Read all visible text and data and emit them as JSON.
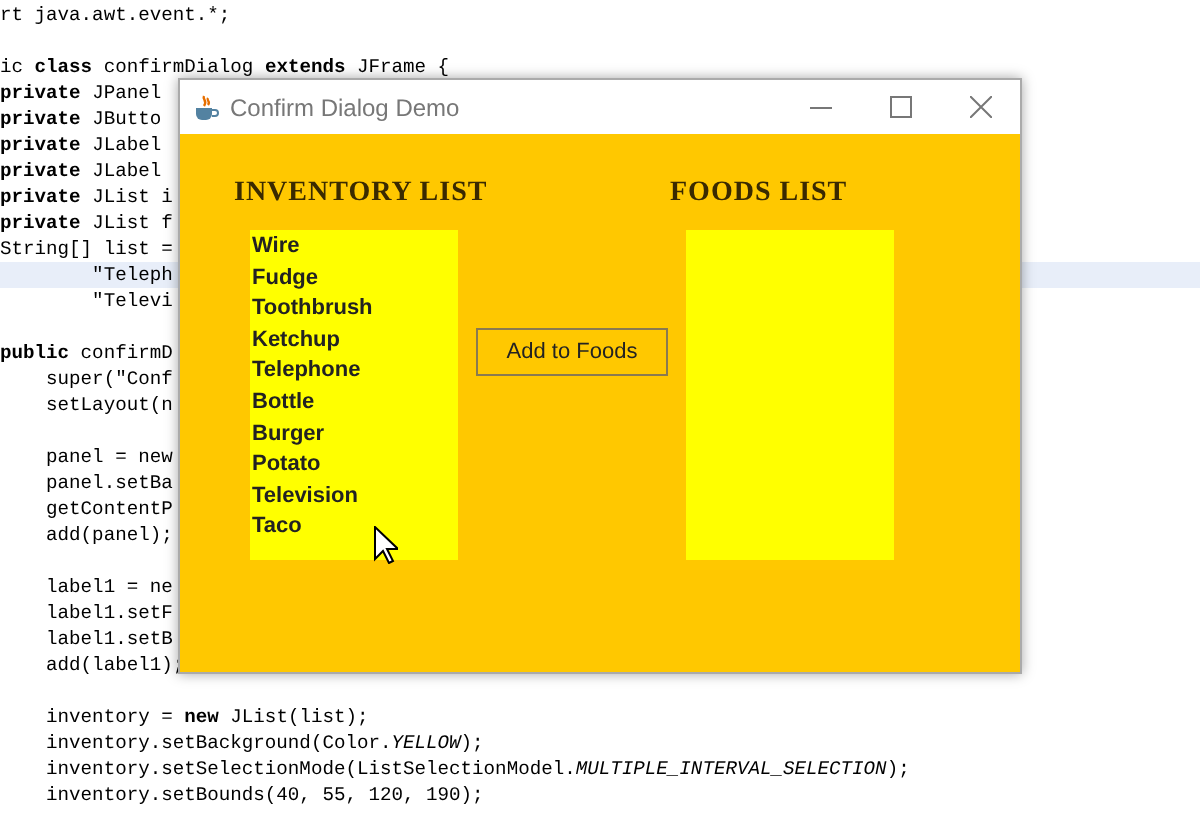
{
  "editor": {
    "blocks": [
      {
        "lines": [
          {
            "text": "rt java.awt.event.*;",
            "highlighted": false
          }
        ]
      },
      {
        "lines": [
          {
            "text": "ic **class** confirmDialog **extends** JFrame {",
            "highlighted": false
          },
          {
            "text": "**private** JPanel",
            "highlighted": false
          },
          {
            "text": "**private** JButto",
            "highlighted": false
          },
          {
            "text": "**private** JLabel",
            "highlighted": false
          },
          {
            "text": "**private** JLabel",
            "highlighted": false
          },
          {
            "text": "**private** JList i",
            "highlighted": false
          },
          {
            "text": "**private** JList f",
            "highlighted": false
          },
          {
            "text": "String[] list =",
            "highlighted": false
          },
          {
            "text": "        \"Teleph",
            "highlighted": true
          },
          {
            "text": "        \"Televi",
            "highlighted": false
          }
        ]
      },
      {
        "lines": [
          {
            "text": "**public** confirmD",
            "highlighted": false
          },
          {
            "text": "    super(\"Conf",
            "highlighted": false
          },
          {
            "text": "    setLayout(n",
            "highlighted": false
          }
        ]
      },
      {
        "lines": [
          {
            "text": "    panel = new",
            "highlighted": false
          },
          {
            "text": "    panel.setBa",
            "highlighted": false
          },
          {
            "text": "    getContentP",
            "highlighted": false
          },
          {
            "text": "    add(panel);",
            "highlighted": false
          }
        ]
      },
      {
        "lines": [
          {
            "text": "    label1 = ne",
            "highlighted": false
          },
          {
            "text": "    label1.setF",
            "highlighted": false
          },
          {
            "text": "    label1.setB",
            "highlighted": false
          },
          {
            "text": "    add(label1);",
            "highlighted": false
          }
        ]
      },
      {
        "lines": [
          {
            "text": "    inventory = **new** JList(list);",
            "highlighted": false
          },
          {
            "text": "    inventory.setBackground(Color.*YELLOW*);",
            "highlighted": false
          },
          {
            "text": "    inventory.setSelectionMode(ListSelectionModel.*MULTIPLE_INTERVAL_SELECTION*);",
            "highlighted": false
          },
          {
            "text": "    inventory.setBounds(40, 55, 120, 190);",
            "highlighted": false
          }
        ]
      }
    ]
  },
  "window": {
    "title": "Confirm Dialog Demo",
    "inventory": {
      "label": "INVENTORY LIST",
      "items": [
        "Wire",
        "Fudge",
        "Toothbrush",
        "Ketchup",
        "Telephone",
        "Bottle",
        "Burger",
        "Potato",
        "Television",
        "Taco"
      ]
    },
    "button": "Add to Foods",
    "foods": {
      "label": "FOODS LIST"
    }
  }
}
